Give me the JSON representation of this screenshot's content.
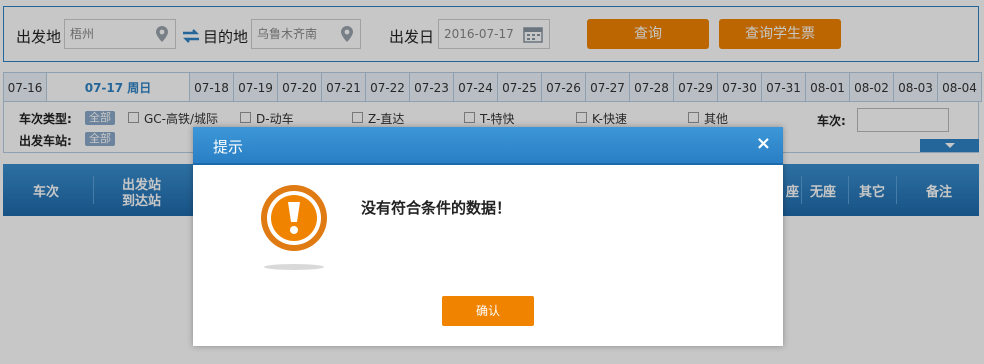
{
  "search": {
    "from_label": "出发地",
    "from_value": "梧州",
    "to_label": "目的地",
    "to_value": "乌鲁木齐南",
    "date_label": "出发日",
    "date_value": "2016-07-17",
    "query_button": "查询",
    "student_button": "查询学生票"
  },
  "date_tabs": [
    {
      "label": "07-16",
      "active": false
    },
    {
      "label": "07-17 周日",
      "active": true
    },
    {
      "label": "07-18",
      "active": false
    },
    {
      "label": "07-19",
      "active": false
    },
    {
      "label": "07-20",
      "active": false
    },
    {
      "label": "07-21",
      "active": false
    },
    {
      "label": "07-22",
      "active": false
    },
    {
      "label": "07-23",
      "active": false
    },
    {
      "label": "07-24",
      "active": false
    },
    {
      "label": "07-25",
      "active": false
    },
    {
      "label": "07-26",
      "active": false
    },
    {
      "label": "07-27",
      "active": false
    },
    {
      "label": "07-28",
      "active": false
    },
    {
      "label": "07-29",
      "active": false
    },
    {
      "label": "07-30",
      "active": false
    },
    {
      "label": "07-31",
      "active": false
    },
    {
      "label": "08-01",
      "active": false
    },
    {
      "label": "08-02",
      "active": false
    },
    {
      "label": "08-03",
      "active": false
    },
    {
      "label": "08-04",
      "active": false
    }
  ],
  "filters": {
    "train_type_label": "车次类型:",
    "all_label": "全部",
    "types": [
      "GC-高铁/城际",
      "D-动车",
      "Z-直达",
      "T-特快",
      "K-快速",
      "其他"
    ],
    "station_label": "出发车站:",
    "station_all_label": "全部",
    "train_no_label": "车次:"
  },
  "table_header": {
    "train_no": "车次",
    "from_station": "出发站",
    "to_station": "到达站",
    "no_seat": "无座",
    "other": "其它",
    "remark": "备注",
    "partial_seat": "座"
  },
  "dialog": {
    "title": "提示",
    "close": "×",
    "message": "没有符合条件的数据！",
    "ok_button": "确认"
  },
  "colors": {
    "brand_blue": "#2f83c5",
    "accent_orange": "#f08300"
  },
  "icons": [
    "map-pin-icon",
    "swap-arrows-icon",
    "calendar-icon",
    "close-icon",
    "warning-icon",
    "chevron-down-icon"
  ]
}
